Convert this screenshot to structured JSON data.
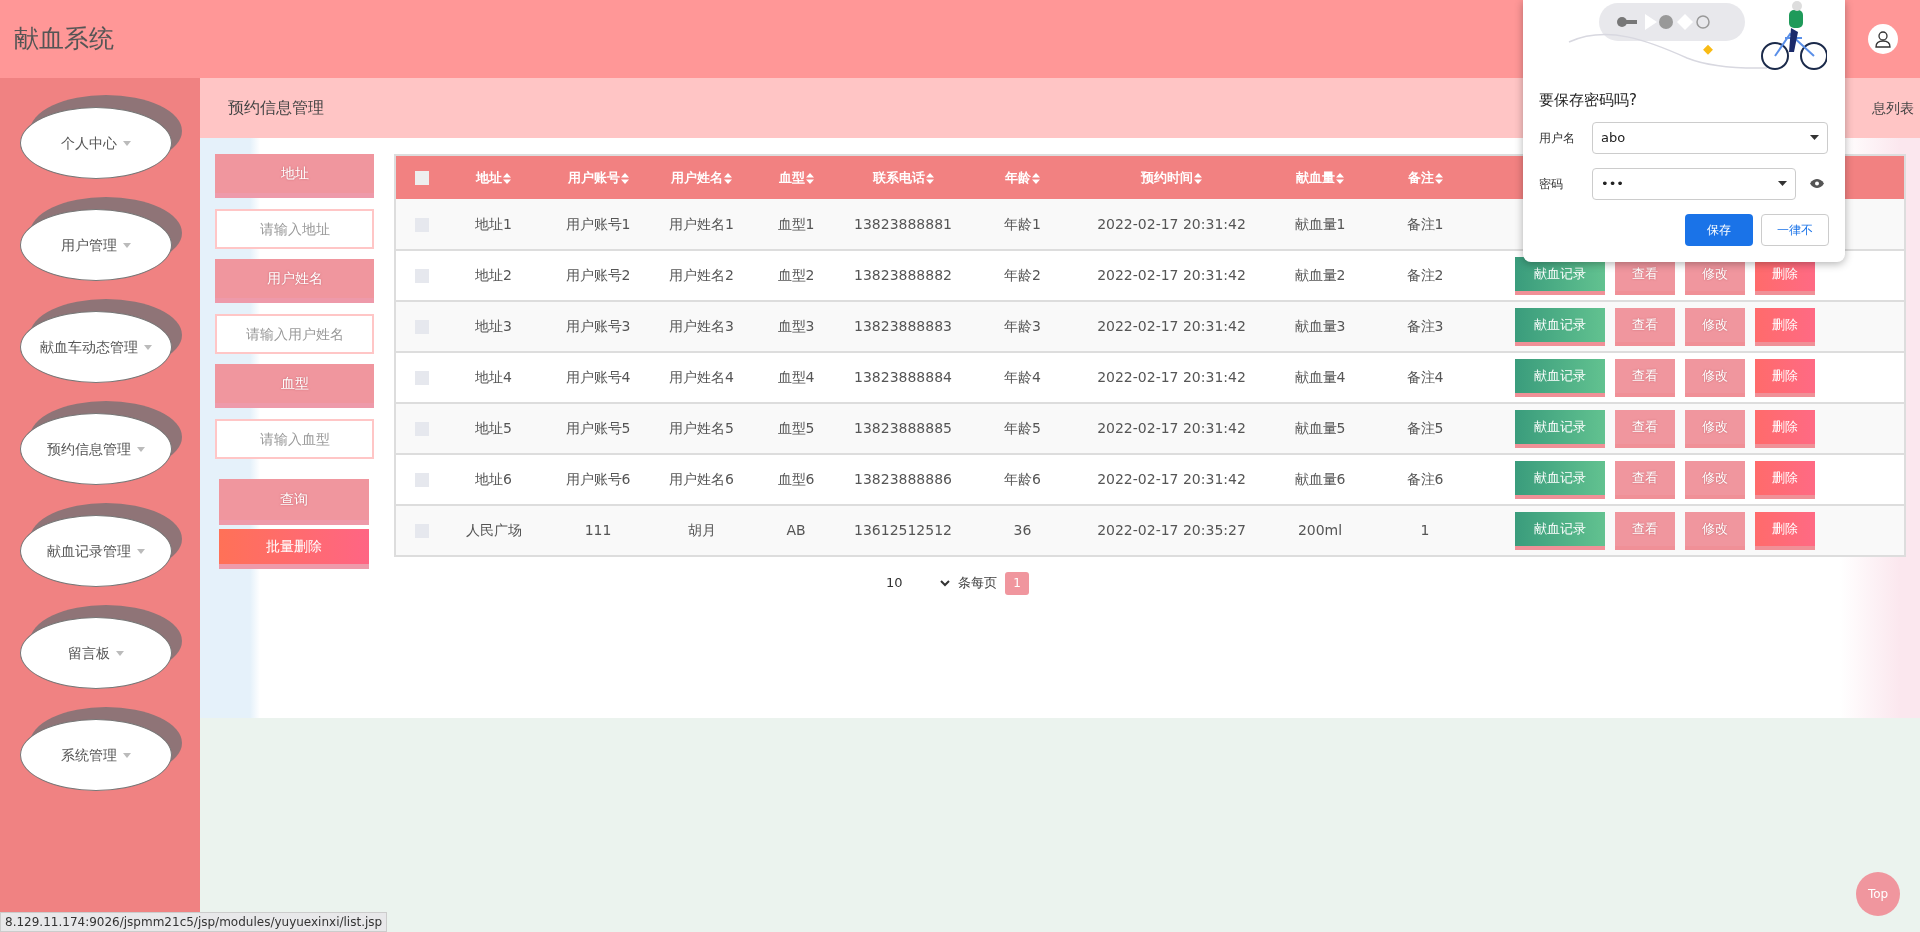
{
  "header": {
    "title": "献血系统"
  },
  "sidebar": {
    "items": [
      {
        "label": "个人中心"
      },
      {
        "label": "用户管理"
      },
      {
        "label": "献血车动态管理"
      },
      {
        "label": "预约信息管理"
      },
      {
        "label": "献血记录管理"
      },
      {
        "label": "留言板"
      },
      {
        "label": "系统管理"
      }
    ]
  },
  "breadcrumb": {
    "title": "预约信息管理",
    "right_text": "息列表"
  },
  "search": {
    "fields": [
      {
        "label": "地址",
        "placeholder": "请输入地址"
      },
      {
        "label": "用户姓名",
        "placeholder": "请输入用户姓名"
      },
      {
        "label": "血型",
        "placeholder": "请输入血型"
      }
    ],
    "buttons": [
      {
        "kind": "query",
        "label": "查询"
      },
      {
        "kind": "batch_delete",
        "label": "批量删除"
      }
    ]
  },
  "table": {
    "all_checked": false,
    "columns": [
      "地址",
      "用户账号",
      "用户姓名",
      "血型",
      "联系电话",
      "年龄",
      "预约时间",
      "献血量",
      "备注"
    ],
    "rows": [
      {
        "checked": false,
        "cells": [
          "地址1",
          "用户账号1",
          "用户姓名1",
          "血型1",
          "13823888881",
          "年龄1",
          "2022-02-17 20:31:42",
          "献血量1",
          "备注1"
        ]
      },
      {
        "checked": false,
        "cells": [
          "地址2",
          "用户账号2",
          "用户姓名2",
          "血型2",
          "13823888882",
          "年龄2",
          "2022-02-17 20:31:42",
          "献血量2",
          "备注2"
        ],
        "actions": [
          {
            "kind": "record",
            "label": "献血记录"
          },
          {
            "kind": "light",
            "label": "查看"
          },
          {
            "kind": "light",
            "label": "修改"
          },
          {
            "kind": "danger",
            "label": "删除"
          }
        ]
      },
      {
        "checked": false,
        "cells": [
          "地址3",
          "用户账号3",
          "用户姓名3",
          "血型3",
          "13823888883",
          "年龄3",
          "2022-02-17 20:31:42",
          "献血量3",
          "备注3"
        ],
        "actions": [
          {
            "kind": "record",
            "label": "献血记录"
          },
          {
            "kind": "light",
            "label": "查看"
          },
          {
            "kind": "light",
            "label": "修改"
          },
          {
            "kind": "danger",
            "label": "删除"
          }
        ]
      },
      {
        "checked": false,
        "cells": [
          "地址4",
          "用户账号4",
          "用户姓名4",
          "血型4",
          "13823888884",
          "年龄4",
          "2022-02-17 20:31:42",
          "献血量4",
          "备注4"
        ],
        "actions": [
          {
            "kind": "record",
            "label": "献血记录"
          },
          {
            "kind": "light",
            "label": "查看"
          },
          {
            "kind": "light",
            "label": "修改"
          },
          {
            "kind": "danger",
            "label": "删除"
          }
        ]
      },
      {
        "checked": false,
        "cells": [
          "地址5",
          "用户账号5",
          "用户姓名5",
          "血型5",
          "13823888885",
          "年龄5",
          "2022-02-17 20:31:42",
          "献血量5",
          "备注5"
        ],
        "actions": [
          {
            "kind": "record",
            "label": "献血记录"
          },
          {
            "kind": "light",
            "label": "查看"
          },
          {
            "kind": "light",
            "label": "修改"
          },
          {
            "kind": "danger",
            "label": "删除"
          }
        ]
      },
      {
        "checked": false,
        "cells": [
          "地址6",
          "用户账号6",
          "用户姓名6",
          "血型6",
          "13823888886",
          "年龄6",
          "2022-02-17 20:31:42",
          "献血量6",
          "备注6"
        ],
        "actions": [
          {
            "kind": "record",
            "label": "献血记录"
          },
          {
            "kind": "light",
            "label": "查看"
          },
          {
            "kind": "light",
            "label": "修改"
          },
          {
            "kind": "danger",
            "label": "删除"
          }
        ]
      },
      {
        "checked": false,
        "cells": [
          "人民广场",
          "111",
          "胡月",
          "AB",
          "13612512512",
          "36",
          "2022-02-17 20:35:27",
          "200ml",
          "1"
        ],
        "actions": [
          {
            "kind": "record",
            "label": "献血记录"
          },
          {
            "kind": "light",
            "label": "查看"
          },
          {
            "kind": "light",
            "label": "修改"
          },
          {
            "kind": "danger",
            "label": "删除"
          }
        ]
      }
    ]
  },
  "pagination": {
    "page_size": "10",
    "per_page_label": "条每页",
    "pages": [
      {
        "label": "1",
        "selected": true
      }
    ]
  },
  "top_button": "Top",
  "status_url": "8.129.11.174:9026/jspmm21c5/jsp/modules/yuyuexinxi/list.jsp",
  "password_popup": {
    "title": "要保存密码吗?",
    "username_label": "用户名",
    "username": "abo",
    "password_label": "密码",
    "password": "•••",
    "buttons": [
      {
        "kind": "primary",
        "label": "保存"
      },
      {
        "kind": "secondary",
        "label": "一律不"
      }
    ]
  }
}
